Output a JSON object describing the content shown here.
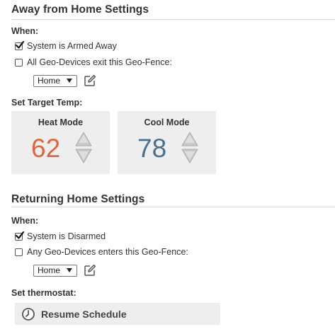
{
  "away": {
    "title": "Away from Home Settings",
    "when_label": "When:",
    "armed_away_label": "System is Armed Away",
    "armed_away_checked": true,
    "geo_exit_label": "All Geo-Devices exit this Geo-Fence:",
    "geo_exit_checked": false,
    "geofence_selected": "Home",
    "target_temp_label": "Set Target Temp:",
    "heat": {
      "title": "Heat Mode",
      "value": "62",
      "color": "#e0643c"
    },
    "cool": {
      "title": "Cool Mode",
      "value": "78",
      "color": "#4a6e94"
    }
  },
  "returning": {
    "title": "Returning Home Settings",
    "when_label": "When:",
    "disarmed_label": "System is Disarmed",
    "disarmed_checked": true,
    "geo_enter_label": "Any Geo-Devices enters this Geo-Fence:",
    "geo_enter_checked": false,
    "geofence_selected": "Home",
    "thermostat_label": "Set thermostat:",
    "resume_label": "Resume Schedule"
  },
  "icons": {
    "checkmark": "check-icon",
    "edit": "pencil-edit-icon",
    "stepper_up": "triangle-up-icon",
    "stepper_down": "triangle-down-icon",
    "clock": "clock-icon"
  }
}
